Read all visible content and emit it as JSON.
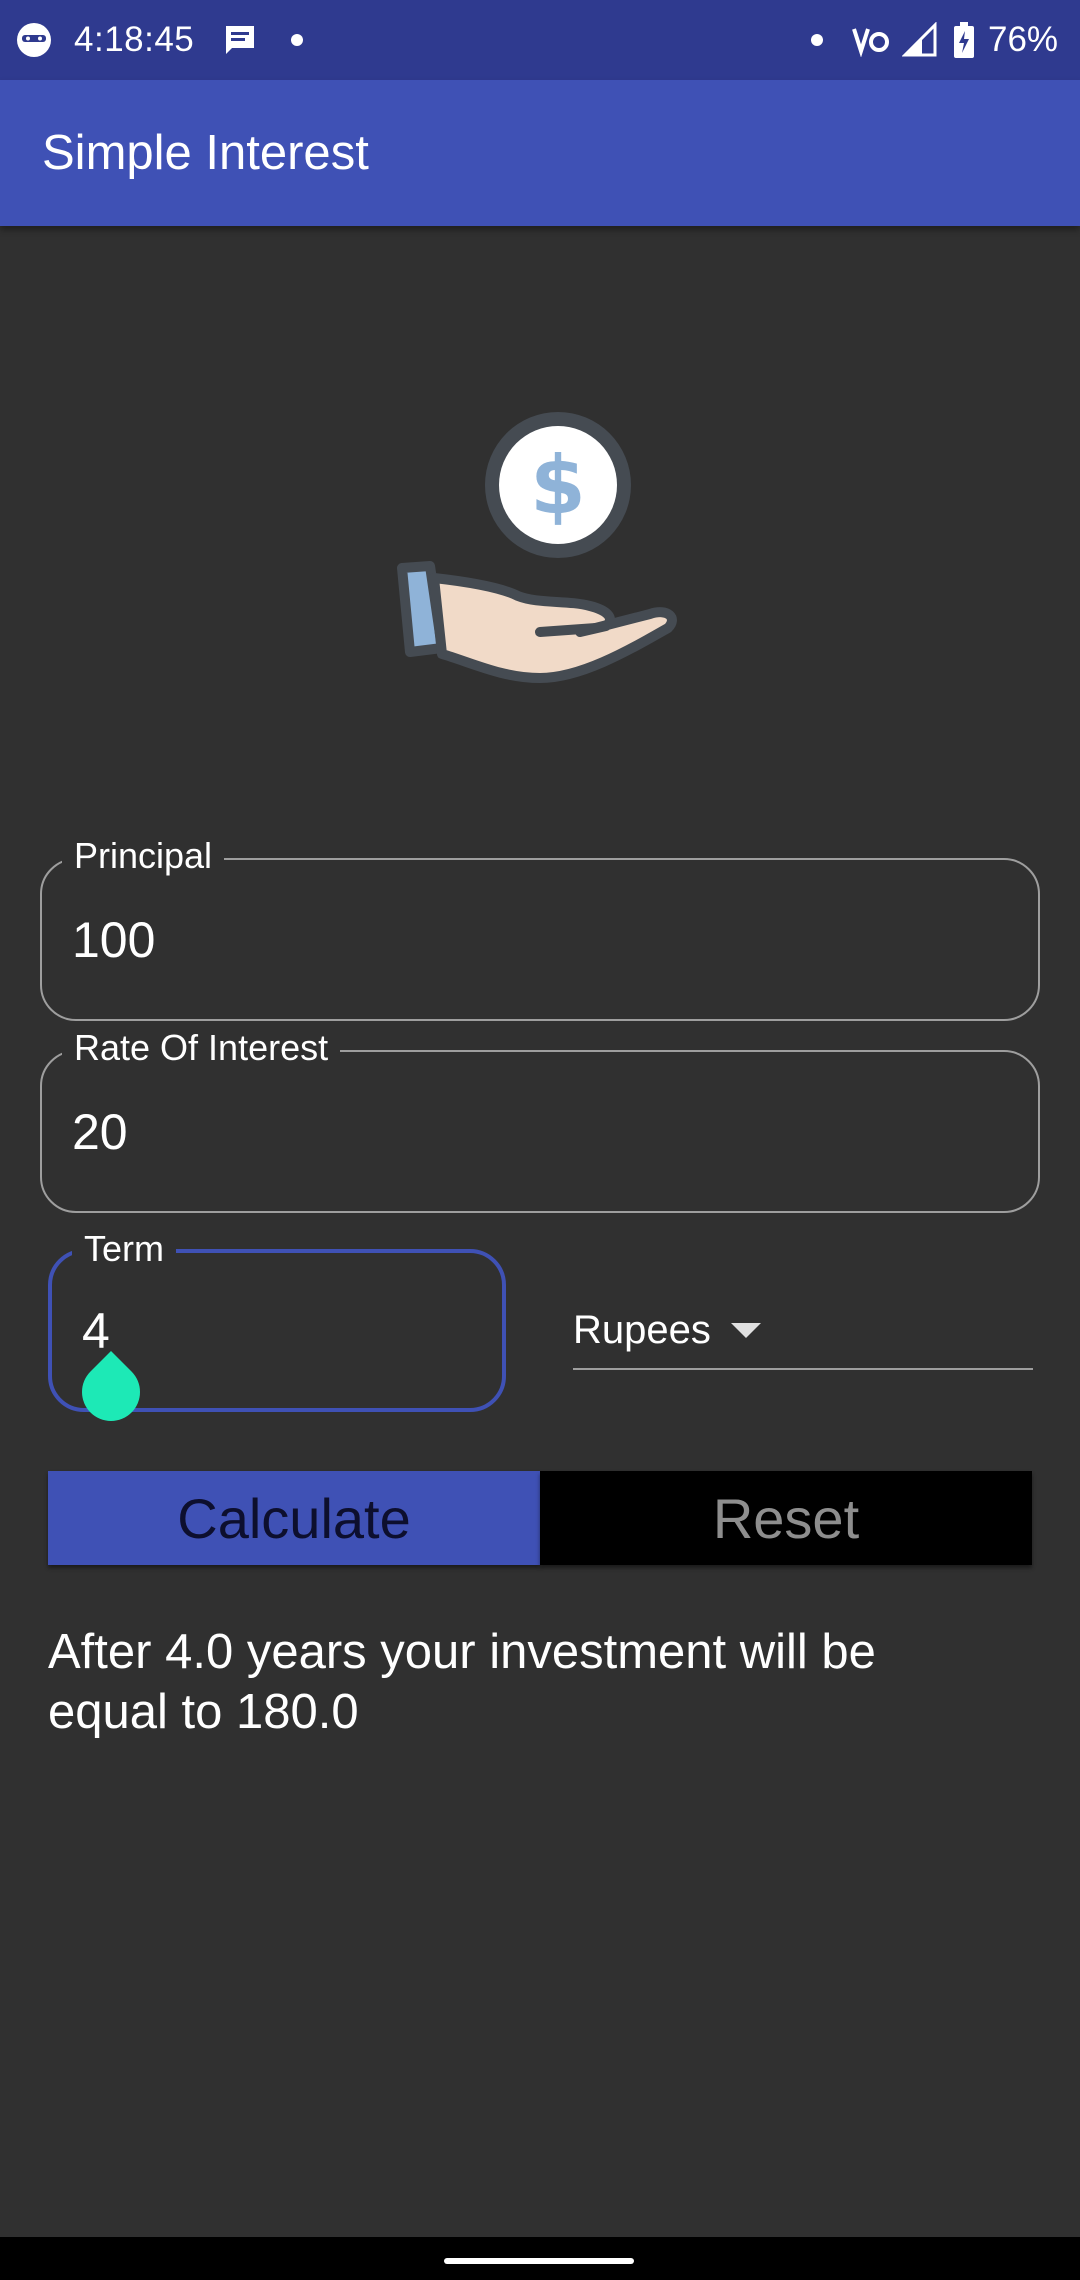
{
  "status_bar": {
    "time": "4:18:45",
    "battery_percent": "76%",
    "icons": [
      "app-notification-icon",
      "message-icon",
      "dot-icon",
      "dot-icon",
      "volte-icon",
      "signal-icon",
      "battery-charging-icon"
    ]
  },
  "app_bar": {
    "title": "Simple Interest"
  },
  "illustration": {
    "icon": "money-hand-icon",
    "symbol": "$"
  },
  "form": {
    "principal": {
      "label": "Principal",
      "value": "100"
    },
    "rate": {
      "label": "Rate Of Interest",
      "value": "20"
    },
    "term": {
      "label": "Term",
      "value": "4"
    },
    "currency": {
      "selected": "Rupees"
    }
  },
  "buttons": {
    "calculate_label": "Calculate",
    "reset_label": "Reset"
  },
  "result": {
    "text": "After 4.0 years your investment will be equal to 180.0"
  },
  "colors": {
    "status_bar": "#2f3a8f",
    "primary": "#3f51b5",
    "background": "#303030",
    "accent": "#1de9b6"
  }
}
